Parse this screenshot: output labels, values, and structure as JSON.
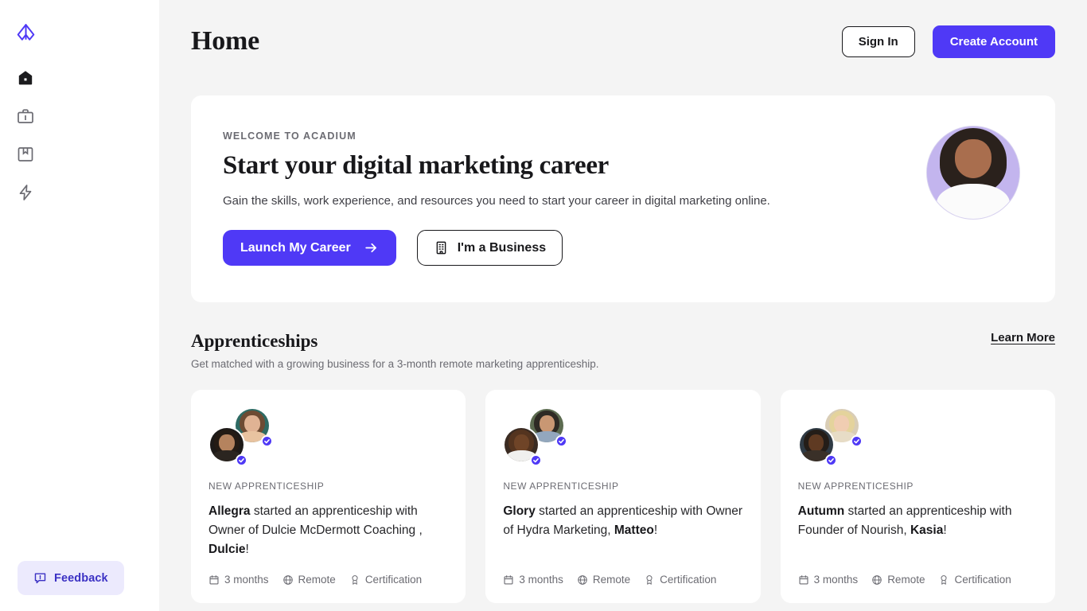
{
  "brand": {
    "logo_icon": "acadium-logo-icon",
    "primary_color": "#4f39f6",
    "page_bg": "#f4f4f4"
  },
  "sidebar": {
    "items": [
      {
        "icon": "home-icon",
        "name": "sidebar-item-home",
        "active": true
      },
      {
        "icon": "briefcase-icon",
        "name": "sidebar-item-jobs",
        "active": false
      },
      {
        "icon": "book-bookmark-icon",
        "name": "sidebar-item-courses",
        "active": false
      },
      {
        "icon": "lightning-bolt-icon",
        "name": "sidebar-item-activity",
        "active": false
      }
    ],
    "feedback": {
      "label": "Feedback",
      "icon": "message-alert-icon"
    }
  },
  "header": {
    "title": "Home",
    "sign_in_label": "Sign In",
    "create_account_label": "Create Account"
  },
  "hero": {
    "eyebrow": "WELCOME TO ACADIUM",
    "title": "Start your digital marketing career",
    "subtitle": "Gain the skills, work experience, and resources you need to start your career in digital marketing online.",
    "primary_cta": {
      "label": "Launch My Career",
      "icon": "arrow-right-icon"
    },
    "secondary_cta": {
      "label": "I'm a Business",
      "icon": "building-icon"
    },
    "photo_alt": "smiling woman portrait",
    "photo_bg": "#c3b5ee"
  },
  "apprenticeships": {
    "title": "Apprenticeships",
    "subtitle": "Get matched with a growing business for a 3-month remote marketing apprenticeship.",
    "learn_more_label": "Learn More",
    "cards": [
      {
        "eyebrow": "NEW APPRENTICESHIP",
        "apprentice": "Allegra",
        "middle": " started an apprenticeship with Owner of Dulcie McDermott Coaching , ",
        "mentor": "Dulcie",
        "suffix": "!",
        "meta": [
          {
            "icon": "calendar-icon",
            "label": "3 months"
          },
          {
            "icon": "globe-icon",
            "label": "Remote"
          },
          {
            "icon": "award-icon",
            "label": "Certification"
          }
        ],
        "avatar_back_bg": "#2e6a63",
        "avatar_front_bg": "#1d1a18"
      },
      {
        "eyebrow": "NEW APPRENTICESHIP",
        "apprentice": "Glory",
        "middle": " started an apprenticeship with Owner of Hydra Marketing, ",
        "mentor": "Matteo",
        "suffix": "!",
        "meta": [
          {
            "icon": "calendar-icon",
            "label": "3 months"
          },
          {
            "icon": "globe-icon",
            "label": "Remote"
          },
          {
            "icon": "award-icon",
            "label": "Certification"
          }
        ],
        "avatar_back_bg": "#5c6b50",
        "avatar_front_bg": "#3a2b22"
      },
      {
        "eyebrow": "NEW APPRENTICESHIP",
        "apprentice": "Autumn",
        "middle": " started an apprenticeship with Founder of Nourish, ",
        "mentor": "Kasia",
        "suffix": "!",
        "meta": [
          {
            "icon": "calendar-icon",
            "label": "3 months"
          },
          {
            "icon": "globe-icon",
            "label": "Remote"
          },
          {
            "icon": "award-icon",
            "label": "Certification"
          }
        ],
        "avatar_back_bg": "#d9cdb6",
        "avatar_front_bg": "#2f3a44"
      }
    ]
  }
}
